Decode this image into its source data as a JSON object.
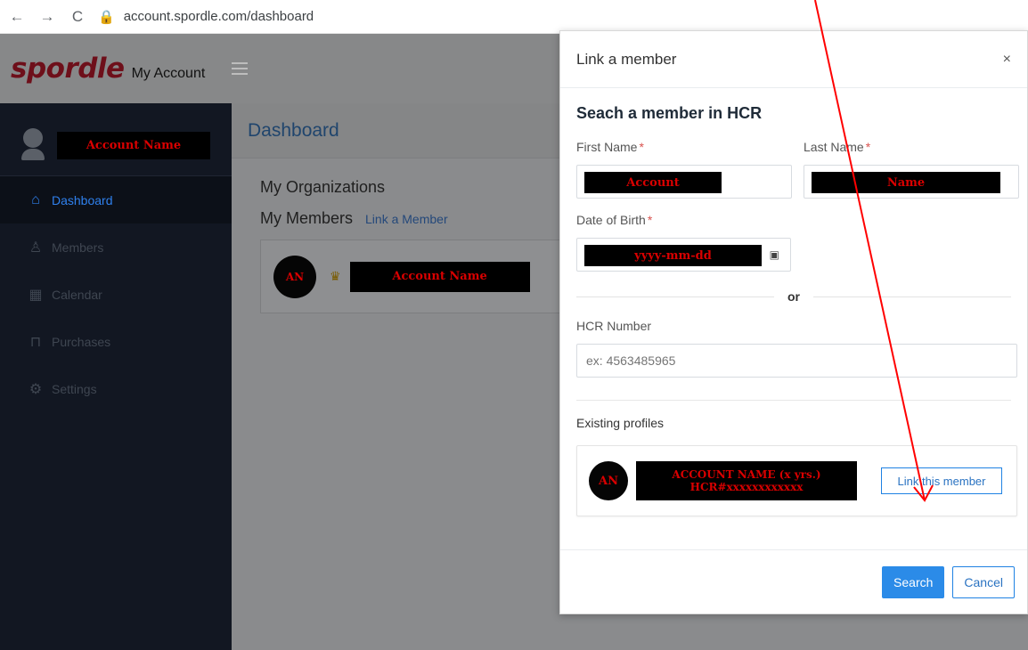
{
  "browser": {
    "back": "←",
    "forward": "→",
    "reload": "C",
    "url": "account.spordle.com/dashboard"
  },
  "brand": {
    "logo": "spordle",
    "app_name": "My Account"
  },
  "sidebar": {
    "profile_name": "Account Name",
    "items": [
      {
        "label": "Dashboard",
        "icon": "home-icon",
        "active": true
      },
      {
        "label": "Members",
        "icon": "user-icon",
        "active": false
      },
      {
        "label": "Calendar",
        "icon": "calendar-icon",
        "active": false
      },
      {
        "label": "Purchases",
        "icon": "cart-icon",
        "active": false
      },
      {
        "label": "Settings",
        "icon": "gear-icon",
        "active": false
      }
    ]
  },
  "dashboard": {
    "title": "Dashboard",
    "organizations": "My Organizations",
    "members": "My Members",
    "link_member": "Link a Member",
    "member_badge": "AN",
    "member_name": "Account Name"
  },
  "modal": {
    "title": "Link a member",
    "close": "×",
    "heading": "Seach a member in HCR",
    "first_name_label": "First Name",
    "last_name_label": "Last Name",
    "required": "*",
    "first_name_value": "Account",
    "last_name_value": "Name",
    "dob_label": "Date of Birth",
    "dob_value": "yyyy-mm-dd",
    "or": "or",
    "hcr_label": "HCR Number",
    "hcr_placeholder": "ex: 4563485965",
    "existing_profiles": "Existing profiles",
    "profile_badge": "AN",
    "profile_name": "ACCOUNT NAME (x yrs.)",
    "profile_hcr": "HCR#xxxxxxxxxxxx",
    "link_this_member": "Link this member",
    "search": "Search",
    "cancel": "Cancel"
  },
  "colors": {
    "accent": "#2b8be8",
    "annotation": "#ff0000",
    "redaction_text": "#d90000"
  }
}
